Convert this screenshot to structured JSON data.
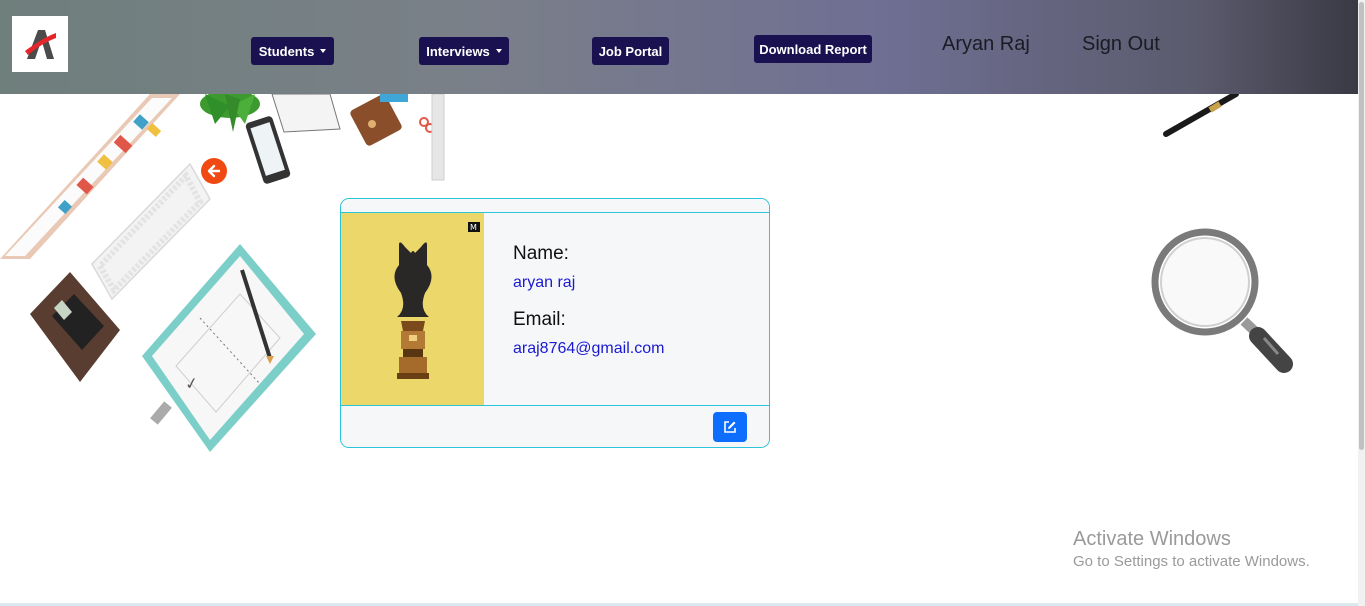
{
  "navbar": {
    "students_label": "Students",
    "interviews_label": "Interviews",
    "job_portal_label": "Job Portal",
    "download_report_label": "Download Report",
    "user_name": "Aryan Raj",
    "sign_out_label": "Sign Out"
  },
  "profile": {
    "name_label": "Name:",
    "name_value": "aryan raj",
    "email_label": "Email:",
    "email_value": "araj8764@gmail.com"
  },
  "watermark": {
    "title": "Activate Windows",
    "subtitle": "Go to Settings to activate Windows."
  },
  "icons": {
    "back": "arrow-left-icon",
    "edit": "pencil-square-icon",
    "logo": "brand-logo"
  },
  "colors": {
    "nav_button": "#1a1150",
    "back_arrow": "#f04a12",
    "edit_button": "#0d6efd",
    "card_border": "#2cc4da",
    "photo_bg": "#ecd76b"
  }
}
